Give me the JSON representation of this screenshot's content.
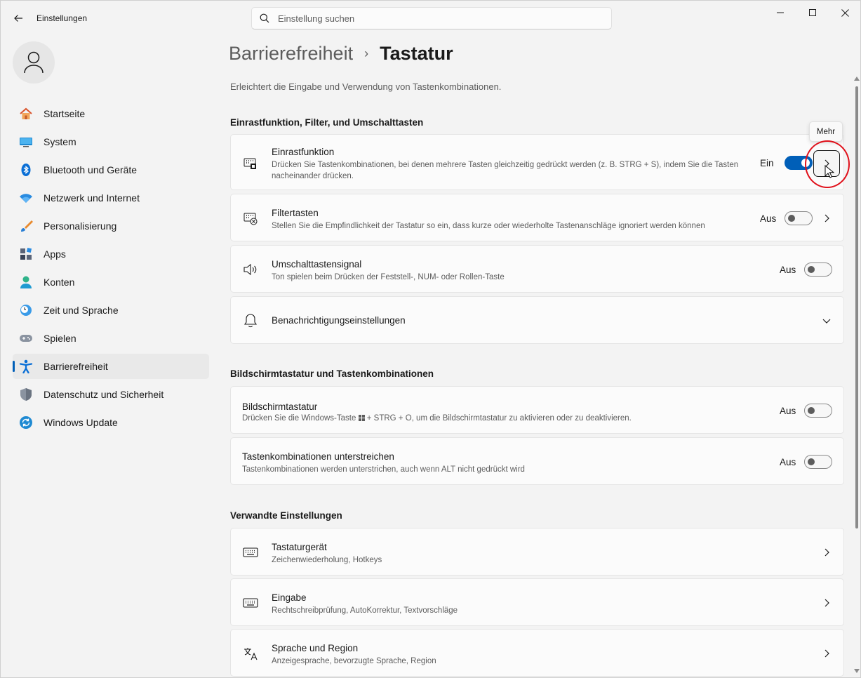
{
  "app": {
    "title": "Einstellungen",
    "search_placeholder": "Einstellung suchen"
  },
  "sidebar": {
    "items": [
      {
        "label": "Startseite",
        "icon": "home-icon"
      },
      {
        "label": "System",
        "icon": "display-icon"
      },
      {
        "label": "Bluetooth und Geräte",
        "icon": "bluetooth-icon"
      },
      {
        "label": "Netzwerk und Internet",
        "icon": "wifi-icon"
      },
      {
        "label": "Personalisierung",
        "icon": "brush-icon"
      },
      {
        "label": "Apps",
        "icon": "apps-icon"
      },
      {
        "label": "Konten",
        "icon": "account-icon"
      },
      {
        "label": "Zeit und Sprache",
        "icon": "clock-globe-icon"
      },
      {
        "label": "Spielen",
        "icon": "gamepad-icon"
      },
      {
        "label": "Barrierefreiheit",
        "icon": "accessibility-icon",
        "active": true
      },
      {
        "label": "Datenschutz und Sicherheit",
        "icon": "shield-icon"
      },
      {
        "label": "Windows Update",
        "icon": "update-icon"
      }
    ]
  },
  "breadcrumb": {
    "parent": "Barrierefreiheit",
    "separator": "›",
    "current": "Tastatur"
  },
  "page_description": "Erleichtert die Eingabe und Verwendung von Tastenkombinationen.",
  "sections": {
    "sticky": {
      "title": "Einrastfunktion, Filter, und Umschalttasten",
      "sticky_keys": {
        "title": "Einrastfunktion",
        "subtitle": "Drücken Sie Tastenkombinationen, bei denen mehrere Tasten gleichzeitig gedrückt werden (z. B. STRG + S), indem Sie die Tasten nacheinander drücken.",
        "state": "Ein"
      },
      "filter_keys": {
        "title": "Filtertasten",
        "subtitle": "Stellen Sie die Empfindlichkeit der Tastatur so ein, dass kurze oder wiederholte Tastenanschläge ignoriert werden können",
        "state": "Aus"
      },
      "toggle_keys": {
        "title": "Umschalttastensignal",
        "subtitle": "Ton spielen beim Drücken der Feststell-, NUM- oder Rollen-Taste",
        "state": "Aus"
      },
      "notifications": {
        "title": "Benachrichtigungseinstellungen"
      },
      "tooltip": "Mehr"
    },
    "osk": {
      "title": "Bildschirmtastatur und Tastenkombinationen",
      "on_screen_keyboard": {
        "title": "Bildschirmtastatur",
        "subtitle_before": "Drücken Sie die Windows-Taste",
        "subtitle_after": "+ STRG + O, um die Bildschirmtastatur zu aktivieren oder zu deaktivieren.",
        "state": "Aus"
      },
      "underline": {
        "title": "Tastenkombinationen unterstreichen",
        "subtitle": "Tastenkombinationen werden unterstrichen, auch wenn ALT nicht gedrückt wird",
        "state": "Aus"
      }
    },
    "related": {
      "title": "Verwandte Einstellungen",
      "items": [
        {
          "title": "Tastaturgerät",
          "subtitle": "Zeichenwiederholung, Hotkeys",
          "icon": "keyboard-icon"
        },
        {
          "title": "Eingabe",
          "subtitle": "Rechtschreibprüfung, AutoKorrektur, Textvorschläge",
          "icon": "keyboard-icon"
        },
        {
          "title": "Sprache und Region",
          "subtitle": "Anzeigesprache, bevorzugte Sprache, Region",
          "icon": "language-icon"
        }
      ]
    }
  },
  "colors": {
    "accent": "#005fb8",
    "annotation_ring": "#e0101a"
  }
}
